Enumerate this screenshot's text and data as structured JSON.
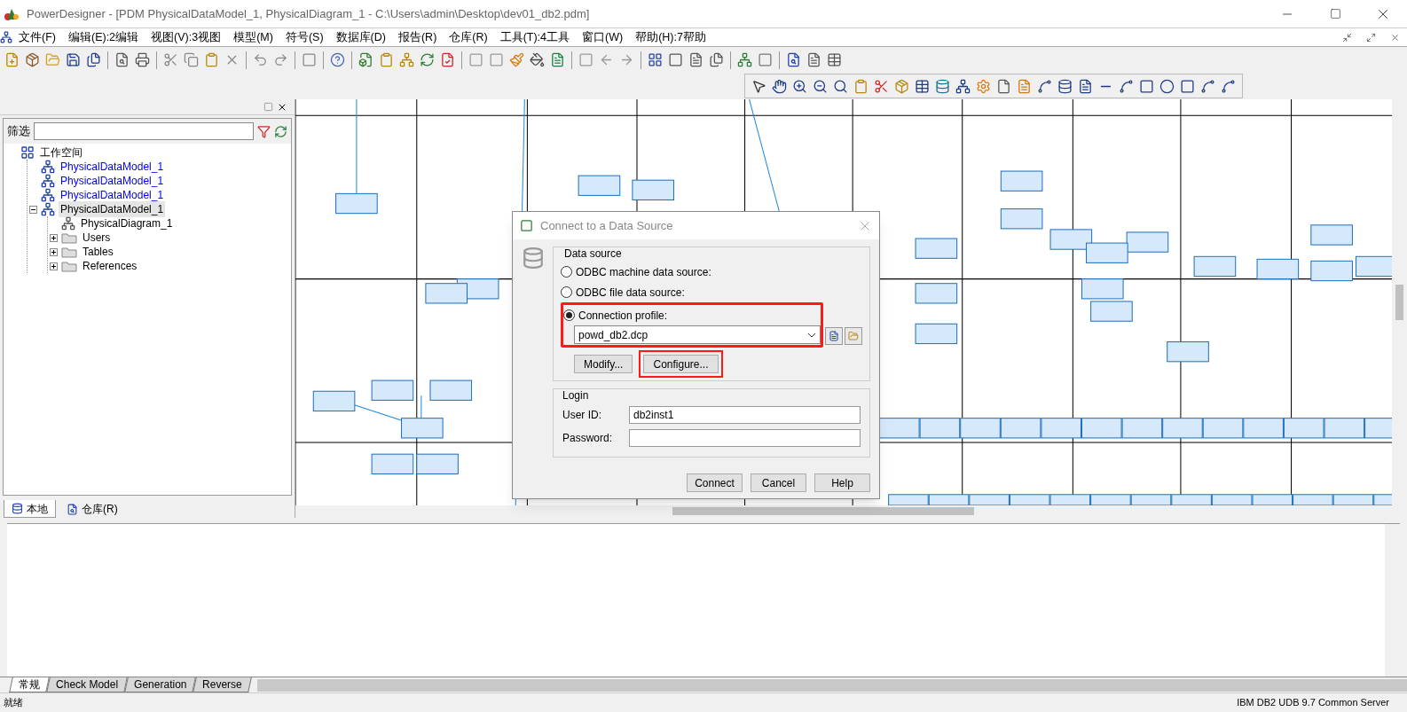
{
  "window": {
    "title": "PowerDesigner - [PDM PhysicalDataModel_1, PhysicalDiagram_1 - C:\\Users\\admin\\Desktop\\dev01_db2.pdm]"
  },
  "menu": [
    "文件(F)",
    "编辑(E):2编辑",
    "视图(V):3视图",
    "模型(M)",
    "符号(S)",
    "数据库(D)",
    "报告(R)",
    "仓库(R)",
    "工具(T):4工具",
    "窗口(W)",
    "帮助(H):7帮助"
  ],
  "browser": {
    "filter_label": "筛选",
    "tree": [
      {
        "label": "工作空间",
        "kind": "workspace",
        "selected": false,
        "children": [
          {
            "label": "PhysicalDataModel_1",
            "kind": "model",
            "color": "#0000ff",
            "selected": false
          },
          {
            "label": "PhysicalDataModel_1",
            "kind": "model",
            "color": "#0000ff",
            "selected": false
          },
          {
            "label": "PhysicalDataModel_1",
            "kind": "model",
            "color": "#0000ff",
            "selected": false
          },
          {
            "label": "PhysicalDataModel_1",
            "kind": "model",
            "color": "#000000",
            "selected": true,
            "expanded": true,
            "children": [
              {
                "label": "PhysicalDiagram_1",
                "kind": "diagram",
                "selected": false
              },
              {
                "label": "Users",
                "kind": "folder",
                "selected": false,
                "expanded": false
              },
              {
                "label": "Tables",
                "kind": "folder",
                "selected": false,
                "expanded": false
              },
              {
                "label": "References",
                "kind": "folder",
                "selected": false,
                "expanded": false
              }
            ]
          }
        ]
      }
    ],
    "tabs": [
      {
        "label": "本地",
        "selected": true
      },
      {
        "label": "仓库(R)",
        "selected": false
      }
    ]
  },
  "dialog": {
    "title": "Connect to a Data Source",
    "group": "Data source",
    "options": [
      {
        "label": "ODBC machine data source:",
        "selected": false
      },
      {
        "label": "ODBC file data source:",
        "selected": false
      },
      {
        "label": "Connection profile:",
        "selected": true
      }
    ],
    "profile": "powd_db2.dcp",
    "buttons_mid": [
      "Modify...",
      "Configure..."
    ],
    "login": {
      "title": "Login",
      "user_label": "User ID:",
      "user": "db2inst1",
      "password_label": "Password:"
    },
    "buttons": [
      "Connect",
      "Cancel",
      "Help"
    ]
  },
  "output_tabs": [
    {
      "label": "常规",
      "selected": true
    },
    {
      "label": "Check Model",
      "selected": false
    },
    {
      "label": "Generation",
      "selected": false
    },
    {
      "label": "Reverse",
      "selected": false
    }
  ],
  "status_bar": {
    "left": "就绪",
    "right": "IBM DB2 UDB 9.7 Common Server"
  }
}
